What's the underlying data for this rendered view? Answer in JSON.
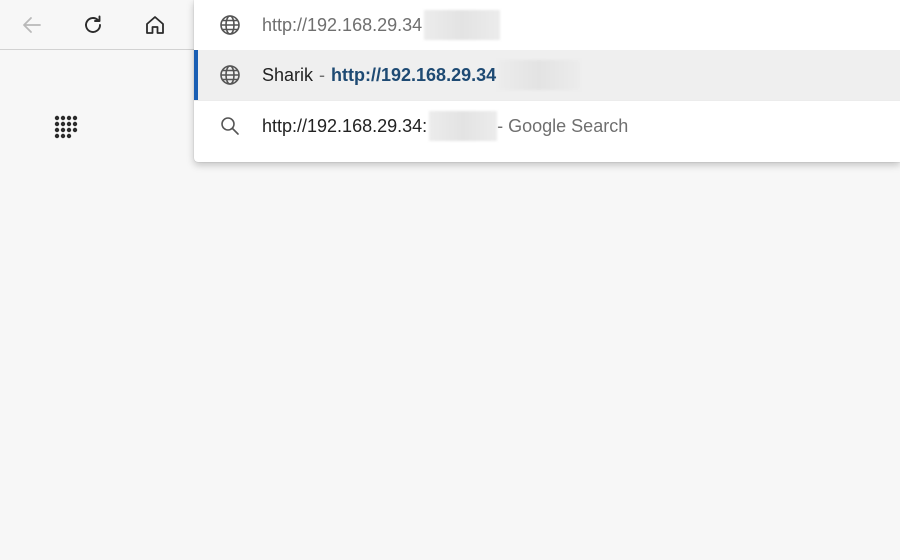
{
  "toolbar": {
    "back_icon": "arrow-left-icon",
    "reload_icon": "reload-icon",
    "home_icon": "home-icon"
  },
  "apps_icon": "grid-icon",
  "omnibox": {
    "address_text": "http://192.168.29.34",
    "suggestions": [
      {
        "icon": "globe-icon",
        "title": "Sharik",
        "separator": "-",
        "url": "http://192.168.29.34",
        "selected": true
      },
      {
        "icon": "search-icon",
        "query": "http://192.168.29.34:",
        "suffix": "- Google Search",
        "selected": false
      }
    ]
  },
  "colors": {
    "background": "#f7f7f7",
    "selection_accent": "#1a5fb4",
    "url_highlight": "#1e4a73"
  }
}
